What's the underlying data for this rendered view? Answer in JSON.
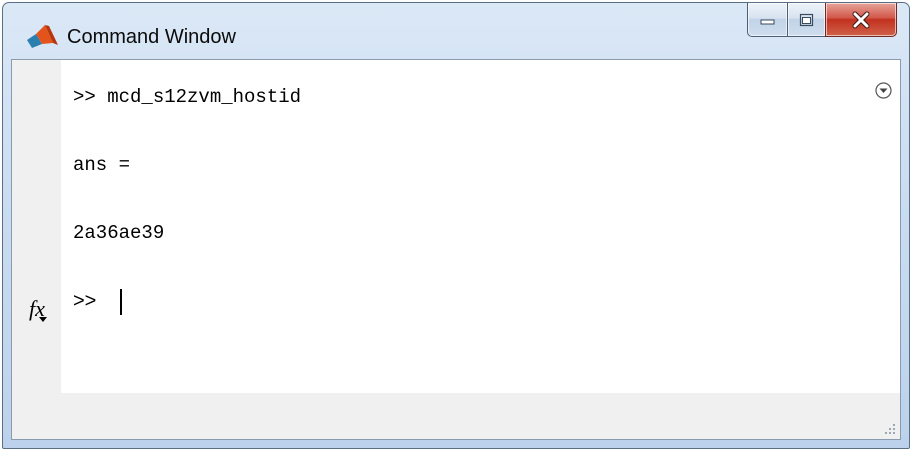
{
  "window": {
    "title": "Command Window",
    "icon": "matlab-logo-icon",
    "caption_buttons": [
      "minimize-icon",
      "maximize-icon",
      "close-icon"
    ]
  },
  "console": {
    "lines": [
      ">> mcd_s12zvm_hostid",
      "ans =",
      "2a36ae39"
    ],
    "prompt": ">>",
    "gutter_icon": "fx-icon",
    "options_icon": "chevron-down-circle-icon"
  }
}
